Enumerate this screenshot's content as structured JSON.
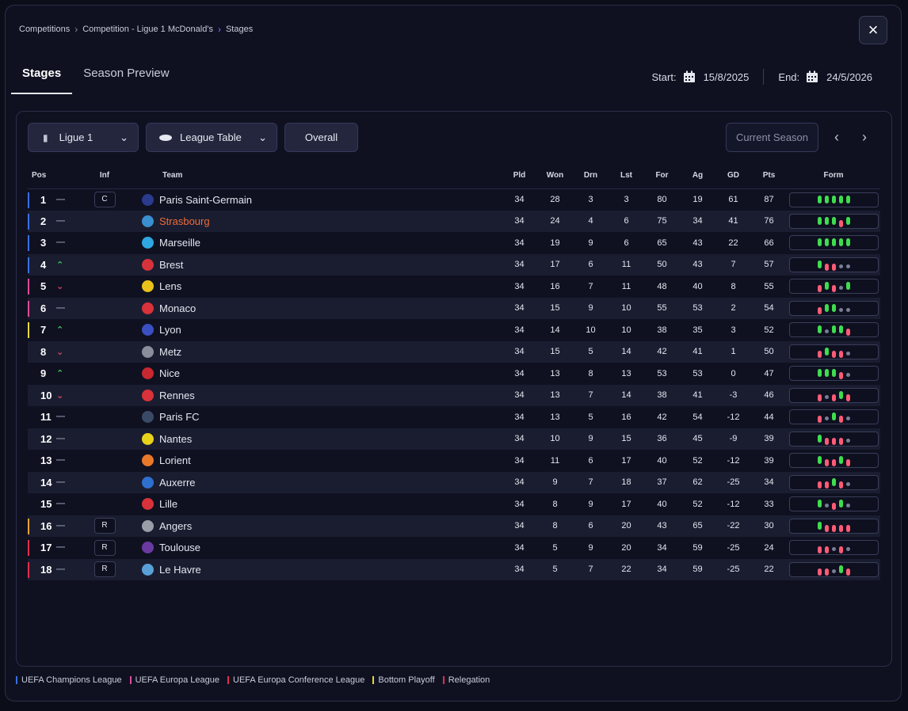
{
  "breadcrumb": [
    "Competitions",
    "Competition - Ligue 1 McDonald's",
    "Stages"
  ],
  "tabs": [
    "Stages",
    "Season Preview"
  ],
  "dates": {
    "start_label": "Start:",
    "start": "15/8/2025",
    "end_label": "End:",
    "end": "24/5/2026"
  },
  "controls": {
    "league": "Ligue 1",
    "view": "League Table",
    "mode": "Overall",
    "season": "Current Season"
  },
  "table": {
    "headers": [
      "Pos",
      "Inf",
      "Team",
      "Pld",
      "Won",
      "Drn",
      "Lst",
      "For",
      "Ag",
      "GD",
      "Pts",
      "Form"
    ],
    "rows": [
      {
        "pos": "1",
        "trend": "same",
        "inf": "C",
        "team": "Paris Saint-Germain",
        "pld": "34",
        "won": "28",
        "drn": "3",
        "lst": "3",
        "for": "80",
        "ag": "19",
        "gd": "61",
        "pts": "87",
        "zone": "#3a6fe0",
        "logo": "#2a3a8c",
        "form": [
          "W",
          "W",
          "W",
          "W",
          "W"
        ]
      },
      {
        "pos": "2",
        "trend": "same",
        "inf": "",
        "team": "Strasbourg",
        "pld": "34",
        "won": "24",
        "drn": "4",
        "lst": "6",
        "for": "75",
        "ag": "34",
        "gd": "41",
        "pts": "76",
        "zone": "#3a6fe0",
        "logo": "#3a8fd0",
        "highlight": true,
        "form": [
          "W",
          "W",
          "W",
          "L",
          "W"
        ]
      },
      {
        "pos": "3",
        "trend": "same",
        "inf": "",
        "team": "Marseille",
        "pld": "34",
        "won": "19",
        "drn": "9",
        "lst": "6",
        "for": "65",
        "ag": "43",
        "gd": "22",
        "pts": "66",
        "zone": "#3a6fe0",
        "logo": "#2fa7e0",
        "form": [
          "W",
          "W",
          "W",
          "W",
          "W"
        ]
      },
      {
        "pos": "4",
        "trend": "up",
        "inf": "",
        "team": "Brest",
        "pld": "34",
        "won": "17",
        "drn": "6",
        "lst": "11",
        "for": "50",
        "ag": "43",
        "gd": "7",
        "pts": "57",
        "zone": "#3a6fe0",
        "logo": "#d8323a",
        "form": [
          "W",
          "L",
          "L",
          "D",
          "D"
        ]
      },
      {
        "pos": "5",
        "trend": "down",
        "inf": "",
        "team": "Lens",
        "pld": "34",
        "won": "16",
        "drn": "7",
        "lst": "11",
        "for": "48",
        "ag": "40",
        "gd": "8",
        "pts": "55",
        "zone": "#e04a9a",
        "logo": "#e8c21a",
        "form": [
          "L",
          "W",
          "L",
          "D",
          "W"
        ]
      },
      {
        "pos": "6",
        "trend": "same",
        "inf": "",
        "team": "Monaco",
        "pld": "34",
        "won": "15",
        "drn": "9",
        "lst": "10",
        "for": "55",
        "ag": "53",
        "gd": "2",
        "pts": "54",
        "zone": "#e04a9a",
        "logo": "#d8323a",
        "form": [
          "L",
          "W",
          "W",
          "D",
          "D"
        ]
      },
      {
        "pos": "7",
        "trend": "up",
        "inf": "",
        "team": "Lyon",
        "pld": "34",
        "won": "14",
        "drn": "10",
        "lst": "10",
        "for": "38",
        "ag": "35",
        "gd": "3",
        "pts": "52",
        "zone": "#e6d83a",
        "logo": "#3a4fc0",
        "form": [
          "W",
          "D",
          "W",
          "W",
          "L"
        ]
      },
      {
        "pos": "8",
        "trend": "down",
        "inf": "",
        "team": "Metz",
        "pld": "34",
        "won": "15",
        "drn": "5",
        "lst": "14",
        "for": "42",
        "ag": "41",
        "gd": "1",
        "pts": "50",
        "zone": "",
        "logo": "#8a8e9c",
        "form": [
          "L",
          "W",
          "L",
          "L",
          "D"
        ]
      },
      {
        "pos": "9",
        "trend": "up",
        "inf": "",
        "team": "Nice",
        "pld": "34",
        "won": "13",
        "drn": "8",
        "lst": "13",
        "for": "53",
        "ag": "53",
        "gd": "0",
        "pts": "47",
        "zone": "",
        "logo": "#c82830",
        "form": [
          "W",
          "W",
          "W",
          "L",
          "D"
        ]
      },
      {
        "pos": "10",
        "trend": "down",
        "inf": "",
        "team": "Rennes",
        "pld": "34",
        "won": "13",
        "drn": "7",
        "lst": "14",
        "for": "38",
        "ag": "41",
        "gd": "-3",
        "pts": "46",
        "zone": "",
        "logo": "#d8323a",
        "form": [
          "L",
          "D",
          "L",
          "W",
          "L"
        ]
      },
      {
        "pos": "11",
        "trend": "same",
        "inf": "",
        "team": "Paris FC",
        "pld": "34",
        "won": "13",
        "drn": "5",
        "lst": "16",
        "for": "42",
        "ag": "54",
        "gd": "-12",
        "pts": "44",
        "zone": "",
        "logo": "#3a4a66",
        "form": [
          "L",
          "D",
          "W",
          "L",
          "D"
        ]
      },
      {
        "pos": "12",
        "trend": "same",
        "inf": "",
        "team": "Nantes",
        "pld": "34",
        "won": "10",
        "drn": "9",
        "lst": "15",
        "for": "36",
        "ag": "45",
        "gd": "-9",
        "pts": "39",
        "zone": "",
        "logo": "#e8d21a",
        "form": [
          "W",
          "L",
          "L",
          "L",
          "D"
        ]
      },
      {
        "pos": "13",
        "trend": "same",
        "inf": "",
        "team": "Lorient",
        "pld": "34",
        "won": "11",
        "drn": "6",
        "lst": "17",
        "for": "40",
        "ag": "52",
        "gd": "-12",
        "pts": "39",
        "zone": "",
        "logo": "#e8782a",
        "form": [
          "W",
          "L",
          "L",
          "W",
          "L"
        ]
      },
      {
        "pos": "14",
        "trend": "same",
        "inf": "",
        "team": "Auxerre",
        "pld": "34",
        "won": "9",
        "drn": "7",
        "lst": "18",
        "for": "37",
        "ag": "62",
        "gd": "-25",
        "pts": "34",
        "zone": "",
        "logo": "#2f6fd0",
        "form": [
          "L",
          "L",
          "W",
          "L",
          "D"
        ]
      },
      {
        "pos": "15",
        "trend": "same",
        "inf": "",
        "team": "Lille",
        "pld": "34",
        "won": "8",
        "drn": "9",
        "lst": "17",
        "for": "40",
        "ag": "52",
        "gd": "-12",
        "pts": "33",
        "zone": "",
        "logo": "#d8323a",
        "form": [
          "W",
          "D",
          "L",
          "W",
          "D"
        ]
      },
      {
        "pos": "16",
        "trend": "same",
        "inf": "R",
        "team": "Angers",
        "pld": "34",
        "won": "8",
        "drn": "6",
        "lst": "20",
        "for": "43",
        "ag": "65",
        "gd": "-22",
        "pts": "30",
        "zone": "#e8a23a",
        "logo": "#9a9ea8",
        "form": [
          "W",
          "L",
          "L",
          "L",
          "L"
        ]
      },
      {
        "pos": "17",
        "trend": "same",
        "inf": "R",
        "team": "Toulouse",
        "pld": "34",
        "won": "5",
        "drn": "9",
        "lst": "20",
        "for": "34",
        "ag": "59",
        "gd": "-25",
        "pts": "24",
        "zone": "#e0304a",
        "logo": "#6a3aa0",
        "form": [
          "L",
          "L",
          "D",
          "L",
          "D"
        ]
      },
      {
        "pos": "18",
        "trend": "same",
        "inf": "R",
        "team": "Le Havre",
        "pld": "34",
        "won": "5",
        "drn": "7",
        "lst": "22",
        "for": "34",
        "ag": "59",
        "gd": "-25",
        "pts": "22",
        "zone": "#e0304a",
        "logo": "#5aa0d8",
        "form": [
          "L",
          "L",
          "D",
          "W",
          "L"
        ]
      }
    ]
  },
  "legend": [
    {
      "label": "UEFA Champions League",
      "color": "#3a6fe0"
    },
    {
      "label": "UEFA Europa League",
      "color": "#e04a9a"
    },
    {
      "label": "UEFA Europa Conference League",
      "color": "#e0304a"
    },
    {
      "label": "Bottom Playoff",
      "color": "#e6d83a"
    },
    {
      "label": "Relegation",
      "color": "#e0304a"
    }
  ]
}
